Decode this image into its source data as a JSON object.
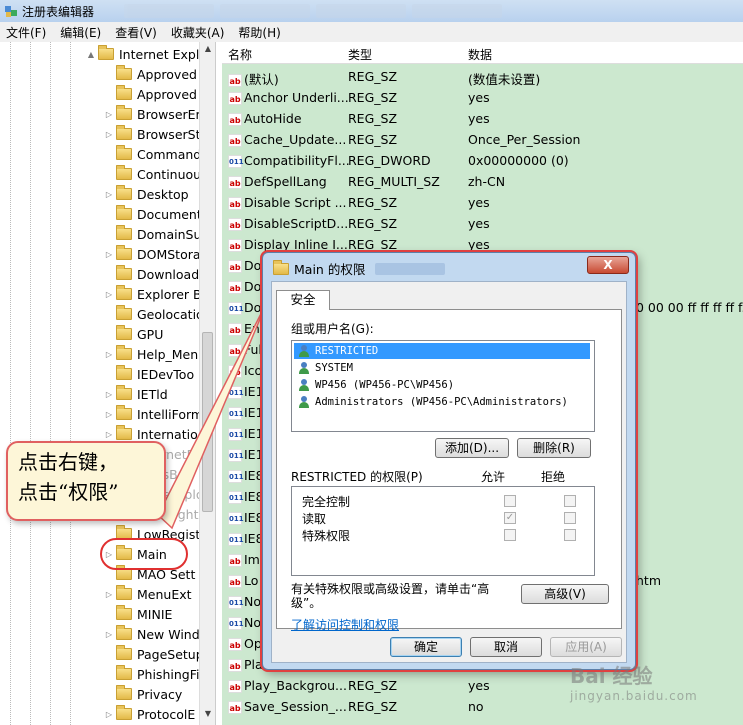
{
  "window": {
    "title": "注册表编辑器"
  },
  "menu": [
    "文件(F)",
    "编辑(E)",
    "查看(V)",
    "收藏夹(A)",
    "帮助(H)"
  ],
  "tree": {
    "items": [
      {
        "label": "Internet Explo",
        "expander": "▲",
        "level": 1
      },
      {
        "label": "Approved",
        "expander": "",
        "level": 2
      },
      {
        "label": "Approved",
        "expander": "",
        "level": 2
      },
      {
        "label": "BrowserEm",
        "expander": "▷",
        "level": 2
      },
      {
        "label": "BrowserSt",
        "expander": "▷",
        "level": 2
      },
      {
        "label": "Command",
        "expander": "",
        "level": 2
      },
      {
        "label": "Continuou",
        "expander": "",
        "level": 2
      },
      {
        "label": "Desktop",
        "expander": "▷",
        "level": 2
      },
      {
        "label": "Document",
        "expander": "",
        "level": 2
      },
      {
        "label": "DomainSu",
        "expander": "",
        "level": 2
      },
      {
        "label": "DOMStora",
        "expander": "▷",
        "level": 2
      },
      {
        "label": "Download",
        "expander": "",
        "level": 2
      },
      {
        "label": "Explorer B",
        "expander": "▷",
        "level": 2
      },
      {
        "label": "Geolocatio",
        "expander": "",
        "level": 2
      },
      {
        "label": "GPU",
        "expander": "",
        "level": 2
      },
      {
        "label": "Help_Men",
        "expander": "▷",
        "level": 2
      },
      {
        "label": "IEDevToo",
        "expander": "",
        "level": 2
      },
      {
        "label": "IETld",
        "expander": "▷",
        "level": 2
      },
      {
        "label": "IntelliForm",
        "expander": "▷",
        "level": 2
      },
      {
        "label": "Internatio",
        "expander": "▷",
        "level": 2
      },
      {
        "label": "InternetRe",
        "expander": "",
        "level": 2
      },
      {
        "label": "LinksBar",
        "expander": "",
        "level": 2
      },
      {
        "label": "LinksExplo",
        "expander": "",
        "level": 2
      },
      {
        "label": "Low Right",
        "expander": "",
        "level": 2
      },
      {
        "label": "LowRegist",
        "expander": "",
        "level": 2
      },
      {
        "label": "Main",
        "expander": "▷",
        "level": 2
      },
      {
        "label": "MAO Sett",
        "expander": "",
        "level": 2
      },
      {
        "label": "MenuExt",
        "expander": "▷",
        "level": 2
      },
      {
        "label": "MINIE",
        "expander": "",
        "level": 2
      },
      {
        "label": "New Wind",
        "expander": "▷",
        "level": 2
      },
      {
        "label": "PageSetup",
        "expander": "",
        "level": 2
      },
      {
        "label": "PhishingFi",
        "expander": "",
        "level": 2
      },
      {
        "label": "Privacy",
        "expander": "",
        "level": 2
      },
      {
        "label": "ProtocolE",
        "expander": "▷",
        "level": 2
      }
    ]
  },
  "list": {
    "headers": [
      "名称",
      "类型",
      "数据"
    ],
    "rows": [
      {
        "icon": "ab",
        "name": "(默认)",
        "type": "REG_SZ",
        "data": "(数值未设置)"
      },
      {
        "icon": "ab",
        "name": "Anchor Underli...",
        "type": "REG_SZ",
        "data": "yes"
      },
      {
        "icon": "ab",
        "name": "AutoHide",
        "type": "REG_SZ",
        "data": "yes"
      },
      {
        "icon": "ab",
        "name": "Cache_Update...",
        "type": "REG_SZ",
        "data": "Once_Per_Session"
      },
      {
        "icon": "num",
        "name": "CompatibilityFl...",
        "type": "REG_DWORD",
        "data": "0x00000000 (0)"
      },
      {
        "icon": "ab",
        "name": "DefSpellLang",
        "type": "REG_MULTI_SZ",
        "data": "zh-CN"
      },
      {
        "icon": "ab",
        "name": "Disable Script ...",
        "type": "REG_SZ",
        "data": "yes"
      },
      {
        "icon": "ab",
        "name": "DisableScriptD...",
        "type": "REG_SZ",
        "data": "yes"
      },
      {
        "icon": "ab",
        "name": "Display Inline I...",
        "type": "REG_SZ",
        "data": "yes"
      },
      {
        "icon": "ab",
        "name": "Do",
        "type": "",
        "data": ""
      },
      {
        "icon": "ab",
        "name": "Do",
        "type": "",
        "data": ""
      },
      {
        "icon": "num",
        "name": "Do",
        "type": "",
        "data": "0 00 00 ff ff ff ff f..."
      },
      {
        "icon": "ab",
        "name": "En",
        "type": "",
        "data": ""
      },
      {
        "icon": "ab",
        "name": "Ful",
        "type": "",
        "data": ""
      },
      {
        "icon": "ab",
        "name": "Ico",
        "type": "",
        "data": ""
      },
      {
        "icon": "num",
        "name": "IE1",
        "type": "",
        "data": ""
      },
      {
        "icon": "num",
        "name": "IE1",
        "type": "",
        "data": ""
      },
      {
        "icon": "num",
        "name": "IE1",
        "type": "",
        "data": ""
      },
      {
        "icon": "num",
        "name": "IE1",
        "type": "",
        "data": ""
      },
      {
        "icon": "num",
        "name": "IE8",
        "type": "",
        "data": ""
      },
      {
        "icon": "num",
        "name": "IE8",
        "type": "",
        "data": ""
      },
      {
        "icon": "num",
        "name": "IE8",
        "type": "",
        "data": ""
      },
      {
        "icon": "num",
        "name": "IE8",
        "type": "",
        "data": ""
      },
      {
        "icon": "ab",
        "name": "Imp",
        "type": "",
        "data": ""
      },
      {
        "icon": "ab",
        "name": "Lo",
        "type": "",
        "data": "htm"
      },
      {
        "icon": "num",
        "name": "No",
        "type": "",
        "data": ""
      },
      {
        "icon": "num",
        "name": "No",
        "type": "",
        "data": ""
      },
      {
        "icon": "ab",
        "name": "Op",
        "type": "",
        "data": ""
      },
      {
        "icon": "ab",
        "name": "Pla",
        "type": "",
        "data": ""
      },
      {
        "icon": "ab",
        "name": "Play_Backgrou...",
        "type": "REG_SZ",
        "data": "yes"
      },
      {
        "icon": "ab",
        "name": "Save_Session_...",
        "type": "REG_SZ",
        "data": "no"
      }
    ]
  },
  "dialog": {
    "title": "Main 的权限",
    "close": "X",
    "tab": "安全",
    "group_label": "组或用户名(G):",
    "users": [
      "RESTRICTED",
      "SYSTEM",
      "WP456 (WP456-PC\\WP456)",
      "Administrators (WP456-PC\\Administrators)"
    ],
    "add_button": "添加(D)...",
    "remove_button": "删除(R)",
    "perm_label": "RESTRICTED 的权限(P)",
    "allow_label": "允许",
    "deny_label": "拒绝",
    "permissions": [
      {
        "name": "完全控制",
        "allow": "",
        "deny": ""
      },
      {
        "name": "读取",
        "allow": "✓",
        "deny": ""
      },
      {
        "name": "特殊权限",
        "allow": "",
        "deny": ""
      }
    ],
    "special_text": "有关特殊权限或高级设置，请单击“高级”。",
    "advanced_button": "高级(V)",
    "learn_link": "了解访问控制和权限",
    "ok": "确定",
    "cancel": "取消",
    "apply": "应用(A)"
  },
  "callout": {
    "line1": "点击右键，",
    "line2": "点击“权限”"
  },
  "watermark": {
    "brand": "Bai 经验",
    "sub": "jingyan.baidu.com"
  }
}
